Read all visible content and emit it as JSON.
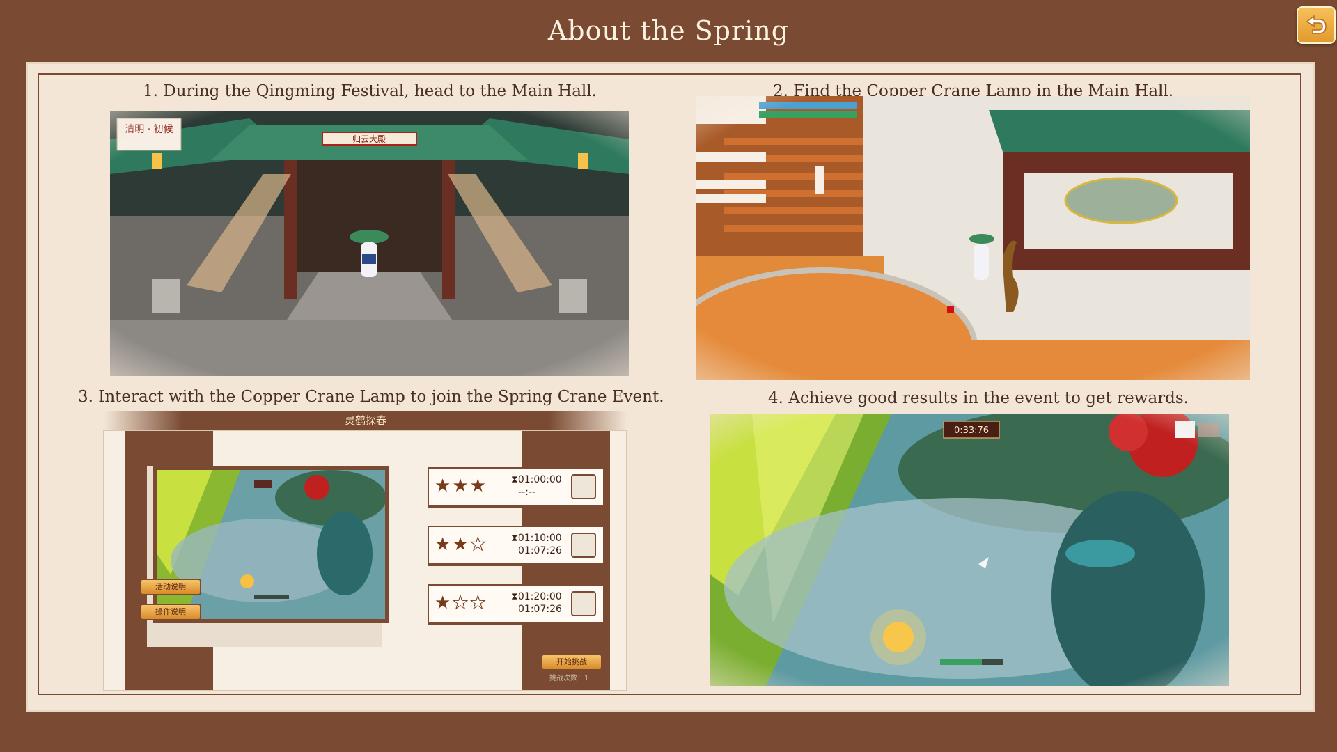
{
  "header": {
    "title": "About the Spring"
  },
  "steps": [
    {
      "caption": "1. During the Qingming Festival, head to the Main Hall.",
      "sign": "清明 · 初候",
      "hall_plaque": "归云大殿"
    },
    {
      "caption": "2. Find the Copper Crane Lamp in the Main Hall."
    },
    {
      "caption": "3. Interact with the Copper Crane Lamp to join the Spring Crane Event."
    },
    {
      "caption": "4. Achieve good results in the event to get rewards.",
      "timer": "0:33:76"
    }
  ],
  "event_dialog": {
    "title": "灵鹤探春",
    "buttons": {
      "activity_info": "活动说明",
      "controls_info": "操作说明",
      "start": "开始挑战"
    },
    "tiers": [
      {
        "stars": 3,
        "target": "01:00:00",
        "best": "--:--"
      },
      {
        "stars": 2,
        "target": "01:10:00",
        "best": "01:07:26"
      },
      {
        "stars": 1,
        "target": "01:20:00",
        "best": "01:07:26"
      }
    ],
    "attempts_label": "挑战次数：1"
  },
  "icons": {
    "back": "back-arrow-icon",
    "star": "star-icon",
    "hourglass": "hourglass-icon",
    "reward": "reward-item-icon"
  },
  "colors": {
    "frame_brown": "#7a4a32",
    "panel_cream": "#f3e6d6",
    "title_text": "#fbf1e0",
    "caption_text": "#4a2f24",
    "button_gold": "#f0b04a"
  }
}
